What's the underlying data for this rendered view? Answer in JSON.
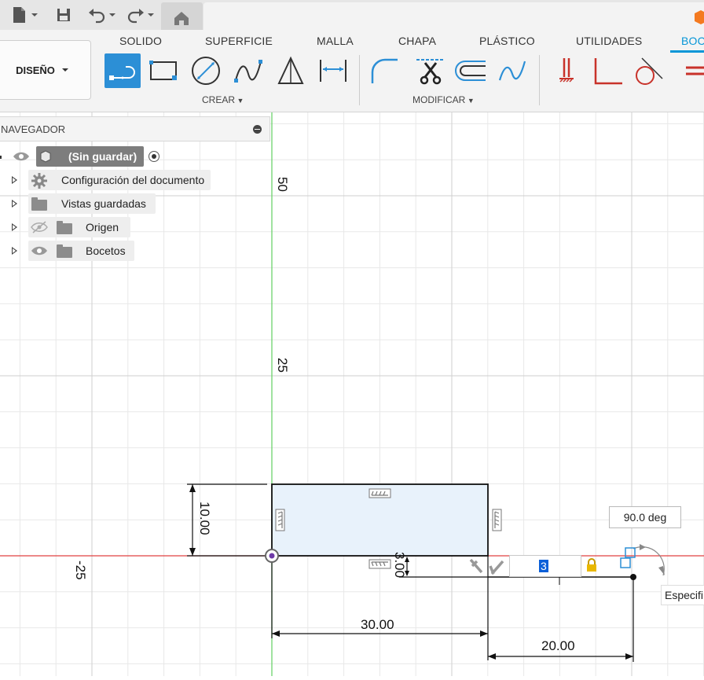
{
  "ribbon": {
    "tabs": [
      "SOLIDO",
      "SUPERFICIE",
      "MALLA",
      "CHAPA",
      "PLÁSTICO",
      "UTILIDADES",
      "BOC"
    ],
    "active_tab": "BOC",
    "workspace_label": "DISEÑO",
    "groups": {
      "create": "CREAR",
      "modify": "MODIFICAR"
    },
    "accent_color": "#0696d7",
    "selected_tool_color": "#2c8fd6",
    "constraint_color": "#c8322a"
  },
  "browser": {
    "title": "NAVEGADOR",
    "root_label": "(Sin guardar)",
    "items": [
      {
        "label": "Configuración del documento",
        "icon": "gear-icon",
        "visibility": "none"
      },
      {
        "label": "Vistas guardadas",
        "icon": "folder-icon",
        "visibility": "none"
      },
      {
        "label": "Origen",
        "icon": "folder-icon",
        "visibility": "hidden"
      },
      {
        "label": "Bocetos",
        "icon": "folder-icon",
        "visibility": "visible"
      }
    ]
  },
  "canvas": {
    "axis_labels": {
      "y50": "50",
      "y25": "25",
      "xneg25": "-25"
    },
    "dimensions": {
      "width": "30.00",
      "height": "10.00",
      "offset": "3.00",
      "extension": "20.00"
    },
    "angle_value": "90.0 deg",
    "length_input_value": "3",
    "hint_text": "Especifi",
    "sketch_fill_color": "#e8f2fb",
    "x_axis_color": "#e04040",
    "y_axis_color": "#4cc24c"
  }
}
